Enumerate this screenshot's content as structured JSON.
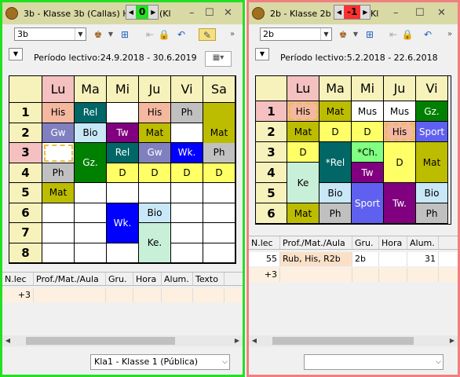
{
  "left": {
    "title": "3b - Klasse 3b (Callas)  H",
    "title_tail": "(Kl",
    "nav_number": "0",
    "combo_value": "3b",
    "period": "Período lectivo:24.9.2018 - 30.6.2019",
    "days": [
      "Lu",
      "Ma",
      "Mi",
      "Ju",
      "Vi",
      "Sa"
    ],
    "periods": [
      "1",
      "2",
      "3",
      "4",
      "5",
      "6",
      "7",
      "8"
    ],
    "cells": [
      {
        "t": "His",
        "c": "#f4b8a0",
        "r": 0,
        "d": 0,
        "h": 1
      },
      {
        "t": "Rel",
        "c": "#006666",
        "fc": "#fff",
        "r": 0,
        "d": 1,
        "h": 1
      },
      {
        "t": "",
        "c": "#ffffff",
        "r": 0,
        "d": 2,
        "h": 1
      },
      {
        "t": "His",
        "c": "#f4b8a0",
        "r": 0,
        "d": 3,
        "h": 1
      },
      {
        "t": "Ph",
        "c": "#c0c0c0",
        "r": 0,
        "d": 4,
        "h": 1
      },
      {
        "t": "Mat",
        "c": "#bcbc00",
        "r": 0,
        "d": 5,
        "h": 3
      },
      {
        "t": "Gw",
        "c": "#8080c0",
        "fc": "#fff",
        "r": 1,
        "d": 0,
        "h": 1
      },
      {
        "t": "Bio",
        "c": "#c8e8f8",
        "r": 1,
        "d": 1,
        "h": 1
      },
      {
        "t": "Tw",
        "c": "#800080",
        "fc": "#fff",
        "r": 1,
        "d": 2,
        "h": 1
      },
      {
        "t": "Mat",
        "c": "#bcbc00",
        "r": 1,
        "d": 3,
        "h": 1
      },
      {
        "t": "",
        "c": "#ffffff",
        "r": 1,
        "d": 4,
        "h": 1
      },
      {
        "t": "",
        "c": "#ffffff",
        "r": 2,
        "d": 0,
        "h": 1,
        "sel": true
      },
      {
        "t": "Gz.",
        "c": "#008000",
        "fc": "#fff",
        "r": 2,
        "d": 1,
        "h": 2
      },
      {
        "t": "Rel",
        "c": "#006666",
        "fc": "#fff",
        "r": 2,
        "d": 2,
        "h": 1
      },
      {
        "t": "Gw",
        "c": "#8080c0",
        "fc": "#fff",
        "r": 2,
        "d": 3,
        "h": 1
      },
      {
        "t": "Wk.",
        "c": "#0000ff",
        "fc": "#fff",
        "r": 2,
        "d": 4,
        "h": 1
      },
      {
        "t": "Ph",
        "c": "#c0c0c0",
        "r": 2,
        "d": 5,
        "h": 1
      },
      {
        "t": "Ph",
        "c": "#c0c0c0",
        "r": 3,
        "d": 0,
        "h": 1
      },
      {
        "t": "D",
        "c": "#ffff66",
        "r": 3,
        "d": 2,
        "h": 1
      },
      {
        "t": "D",
        "c": "#ffff66",
        "r": 3,
        "d": 3,
        "h": 1
      },
      {
        "t": "D",
        "c": "#ffff66",
        "r": 3,
        "d": 4,
        "h": 1
      },
      {
        "t": "D",
        "c": "#ffff66",
        "r": 3,
        "d": 5,
        "h": 1
      },
      {
        "t": "Mat",
        "c": "#bcbc00",
        "r": 4,
        "d": 0,
        "h": 1
      },
      {
        "t": "",
        "c": "#ffffff",
        "r": 4,
        "d": 1,
        "h": 1
      },
      {
        "t": "",
        "c": "#ffffff",
        "r": 4,
        "d": 2,
        "h": 1
      },
      {
        "t": "",
        "c": "#ffffff",
        "r": 4,
        "d": 3,
        "h": 1
      },
      {
        "t": "",
        "c": "#ffffff",
        "r": 4,
        "d": 4,
        "h": 1
      },
      {
        "t": "",
        "c": "#ffffff",
        "r": 4,
        "d": 5,
        "h": 1
      },
      {
        "t": "Wk.",
        "c": "#0000ff",
        "fc": "#fff",
        "r": 5,
        "d": 2,
        "h": 2
      },
      {
        "t": "Bio",
        "c": "#c8e8f8",
        "r": 5,
        "d": 3,
        "h": 1
      },
      {
        "t": "Ke.",
        "c": "#c8f0d8",
        "r": 6,
        "d": 3,
        "h": 2
      }
    ],
    "list_headers": [
      "N.lec",
      "Prof./Mat./Aula",
      "Gru.",
      "Hora",
      "Alum.",
      "Texto"
    ],
    "list_row": [
      "+3",
      "",
      "",
      "",
      "",
      ""
    ],
    "status_select": "Kla1 - Klasse 1 (Pública)"
  },
  "right": {
    "title": "2b - Klasse 2b (",
    "title_tail": "Kl",
    "nav_number": "-1",
    "combo_value": "2b",
    "period": "Período lectivo:5.2.2018 - 22.6.2018",
    "days": [
      "Lu",
      "Ma",
      "Mi",
      "Ju",
      "Vi"
    ],
    "periods": [
      "1",
      "2",
      "3",
      "4",
      "5",
      "6"
    ],
    "cells": [
      {
        "t": "His",
        "c": "#f4b8a0",
        "r": 0,
        "d": 0,
        "h": 1,
        "sel": true
      },
      {
        "t": "Mat",
        "c": "#bcbc00",
        "r": 0,
        "d": 1,
        "h": 1
      },
      {
        "t": "Mus",
        "c": "#ffffff",
        "r": 0,
        "d": 2,
        "h": 1
      },
      {
        "t": "Mus",
        "c": "#ffffff",
        "r": 0,
        "d": 3,
        "h": 1
      },
      {
        "t": "Gz.",
        "c": "#008000",
        "fc": "#fff",
        "r": 0,
        "d": 4,
        "h": 1
      },
      {
        "t": "Mat",
        "c": "#bcbc00",
        "r": 1,
        "d": 0,
        "h": 1
      },
      {
        "t": "D",
        "c": "#ffff66",
        "r": 1,
        "d": 1,
        "h": 1
      },
      {
        "t": "D",
        "c": "#ffff66",
        "r": 1,
        "d": 2,
        "h": 1
      },
      {
        "t": "His",
        "c": "#f4b8a0",
        "r": 1,
        "d": 3,
        "h": 1,
        "sel": true
      },
      {
        "t": "Sport",
        "c": "#6060f0",
        "fc": "#fff",
        "r": 1,
        "d": 4,
        "h": 1
      },
      {
        "t": "D",
        "c": "#ffff66",
        "r": 2,
        "d": 0,
        "h": 1
      },
      {
        "t": "*Rel",
        "c": "#006666",
        "fc": "#fff",
        "r": 2,
        "d": 1,
        "h": 2
      },
      {
        "t": "*Ch.",
        "c": "#80ff80",
        "r": 2,
        "d": 2,
        "h": 1
      },
      {
        "t": "D",
        "c": "#ffff66",
        "r": 2,
        "d": 3,
        "h": 2
      },
      {
        "t": "Mat",
        "c": "#bcbc00",
        "r": 2,
        "d": 4,
        "h": 2
      },
      {
        "t": "Tw",
        "c": "#800080",
        "fc": "#fff",
        "r": 3,
        "d": 2,
        "h": 1
      },
      {
        "t": "Ke",
        "c": "#c8f0d8",
        "r": 3,
        "d": 0,
        "h": 2
      },
      {
        "t": "Bio",
        "c": "#c8e8f8",
        "r": 4,
        "d": 1,
        "h": 1
      },
      {
        "t": "Sport",
        "c": "#6060f0",
        "fc": "#fff",
        "r": 4,
        "d": 2,
        "h": 2
      },
      {
        "t": "Tw.",
        "c": "#800080",
        "fc": "#fff",
        "r": 4,
        "d": 3,
        "h": 2
      },
      {
        "t": "Bio",
        "c": "#c8e8f8",
        "r": 4,
        "d": 4,
        "h": 1
      },
      {
        "t": "Mat",
        "c": "#bcbc00",
        "r": 5,
        "d": 0,
        "h": 1
      },
      {
        "t": "Ph",
        "c": "#c0c0c0",
        "r": 5,
        "d": 1,
        "h": 1
      },
      {
        "t": "Ph",
        "c": "#c0c0c0",
        "r": 5,
        "d": 4,
        "h": 1
      }
    ],
    "list_headers": [
      "N.lec",
      "Prof./Mat./Aula",
      "Gru.",
      "Hora",
      "Alum."
    ],
    "list_rows": [
      [
        "55",
        "Rub, His, R2b",
        "2b",
        "",
        "31"
      ],
      [
        "+3",
        "",
        "",
        "",
        ""
      ]
    ],
    "status_select": ""
  }
}
